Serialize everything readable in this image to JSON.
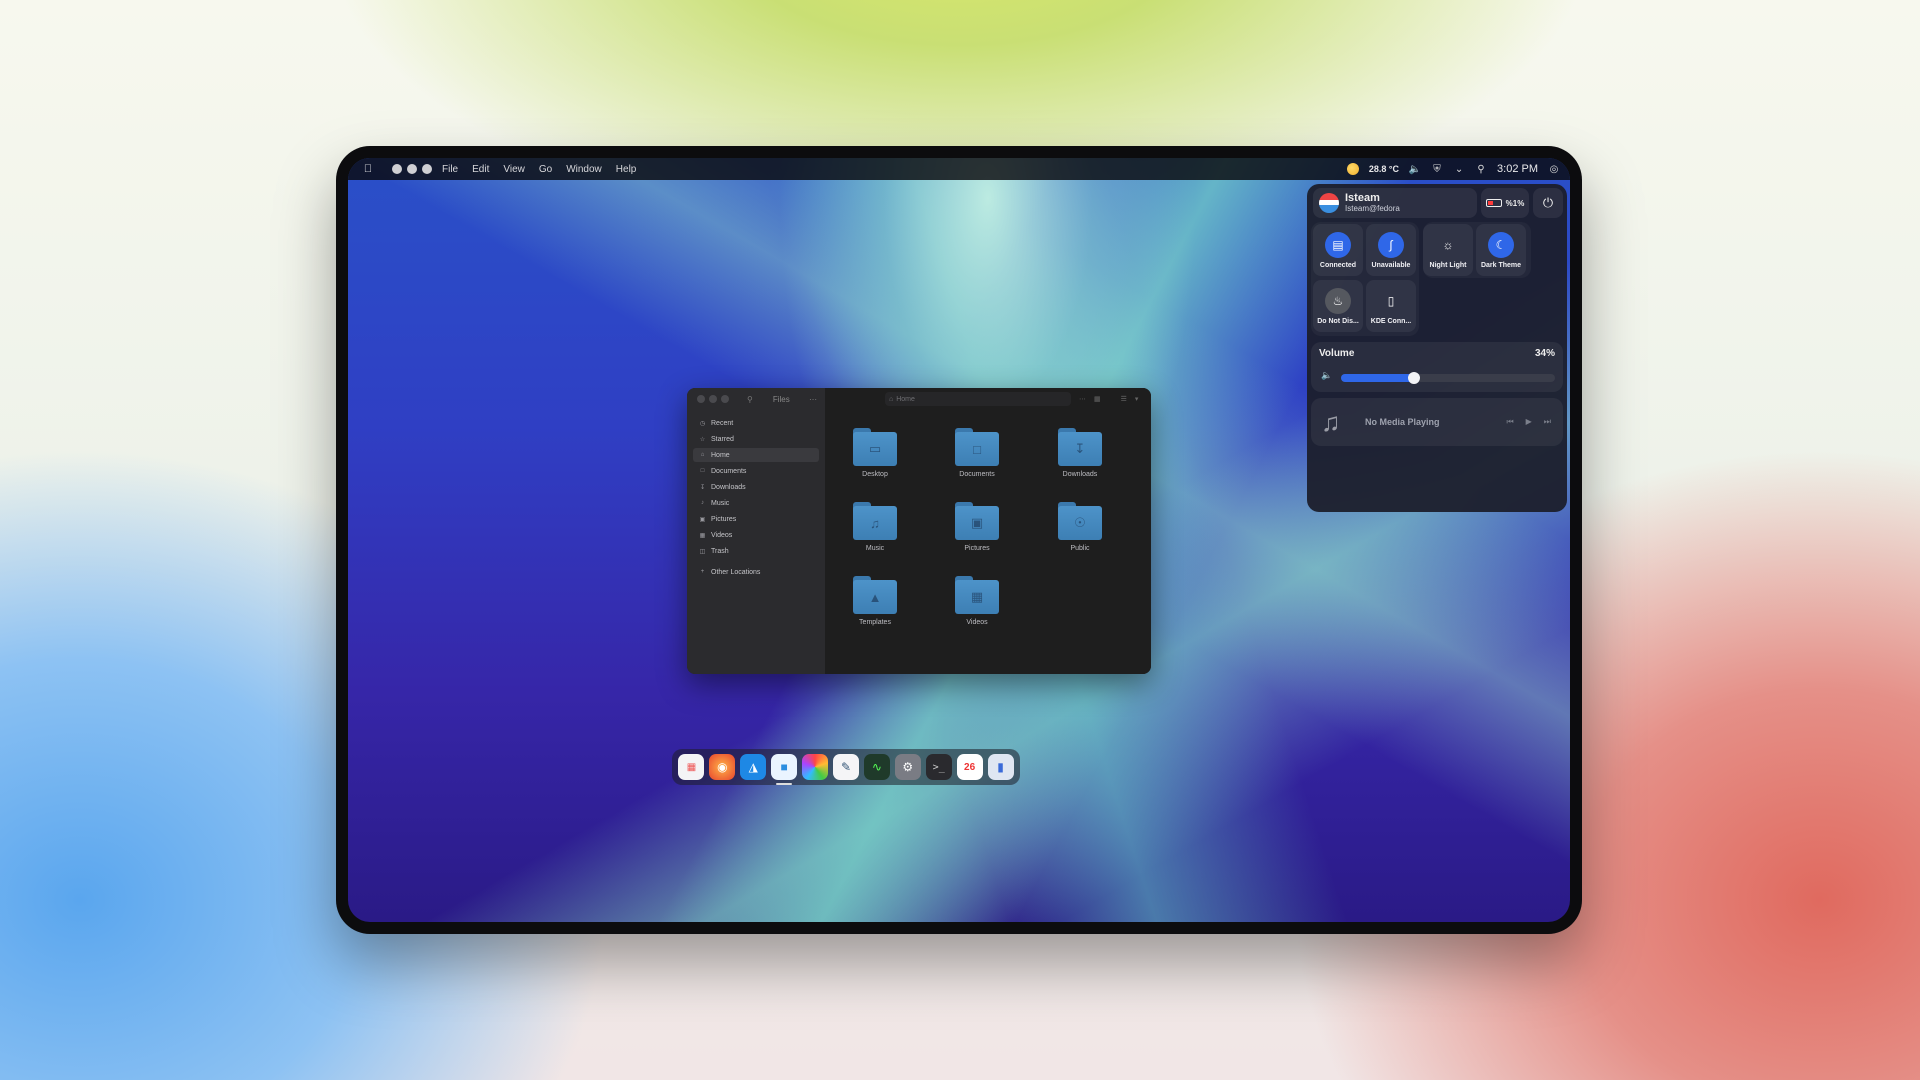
{
  "topbar": {
    "menu": [
      "File",
      "Edit",
      "View",
      "Go",
      "Window",
      "Help"
    ],
    "temperature": "28.8 °C",
    "clock": "3:02 PM"
  },
  "quick_settings": {
    "user_name": "Isteam",
    "user_host": "Isteam@fedora",
    "battery": "%1%",
    "tiles": [
      {
        "label": "Connected",
        "icon": "wired-network-icon"
      },
      {
        "label": "Unavailable",
        "icon": "bluetooth-icon"
      },
      {
        "label": "Night Light",
        "icon": "night-light-icon"
      },
      {
        "label": "Dark Theme",
        "icon": "dark-theme-icon"
      },
      {
        "label": "Do Not Dis...",
        "icon": "bell-icon"
      },
      {
        "label": "KDE Conn...",
        "icon": "phone-icon"
      }
    ],
    "volume_label": "Volume",
    "volume_value": "34%",
    "volume_level": 0.34,
    "media_text": "No Media Playing"
  },
  "files": {
    "title": "Files",
    "path": "Home",
    "sidebar": [
      "Recent",
      "Starred",
      "Home",
      "Documents",
      "Downloads",
      "Music",
      "Pictures",
      "Videos",
      "Trash",
      "Other Locations"
    ],
    "active_item": "Home",
    "folders": [
      "Desktop",
      "Documents",
      "Downloads",
      "Music",
      "Pictures",
      "Public",
      "Templates",
      "Videos"
    ]
  },
  "dock": {
    "calendar_day": "26",
    "apps": [
      "launchpad-icon",
      "firefox-icon",
      "app-store-icon",
      "files-icon",
      "photos-icon",
      "text-editor-icon",
      "system-monitor-icon",
      "settings-icon",
      "terminal-icon",
      "calendar-icon",
      "switcher-icon"
    ]
  },
  "colors": {
    "accent": "#2f67e8",
    "folder": "#4d93c9"
  }
}
